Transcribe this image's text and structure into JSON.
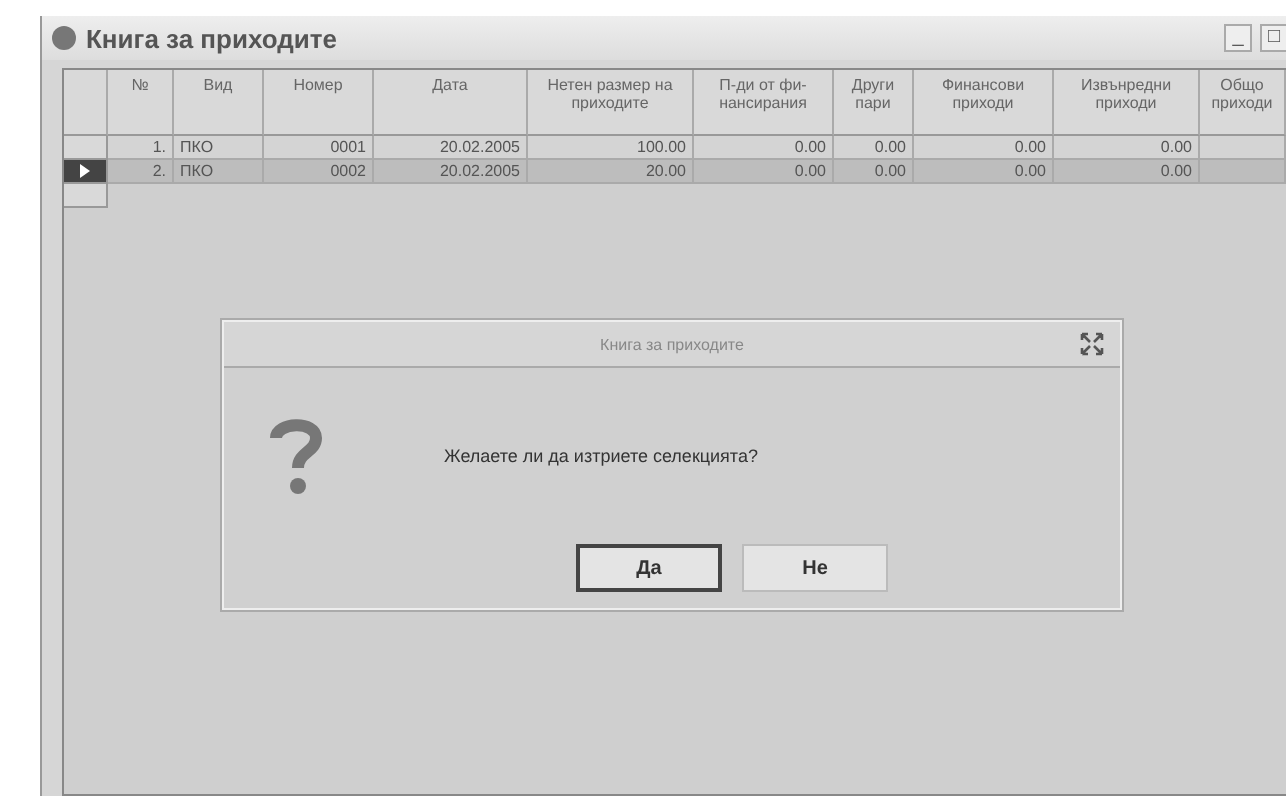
{
  "window": {
    "title": "Книга за приходите",
    "controls": [
      "_",
      "□"
    ]
  },
  "table": {
    "columns": [
      "№",
      "Вид",
      "Номер",
      "Дата",
      "Нетен размер на приходите",
      "П-ди от фи-нансирания",
      "Други пари",
      "Финансови приходи",
      "Извънредни приходи",
      "Общо приходи"
    ],
    "rows": [
      {
        "selected": false,
        "cells": [
          "1.",
          "ПКО",
          "0001",
          "20.02.2005",
          "100.00",
          "0.00",
          "0.00",
          "0.00",
          "0.00",
          ""
        ]
      },
      {
        "selected": true,
        "cells": [
          "2.",
          "ПКО",
          "0002",
          "20.02.2005",
          "20.00",
          "0.00",
          "0.00",
          "0.00",
          "0.00",
          ""
        ]
      }
    ]
  },
  "dialog": {
    "title": "Книга за приходите",
    "message": "Желаете ли да изтриете селекцията?",
    "buttons": [
      {
        "label": "Да",
        "selected": true
      },
      {
        "label": "Не",
        "selected": false
      }
    ]
  }
}
